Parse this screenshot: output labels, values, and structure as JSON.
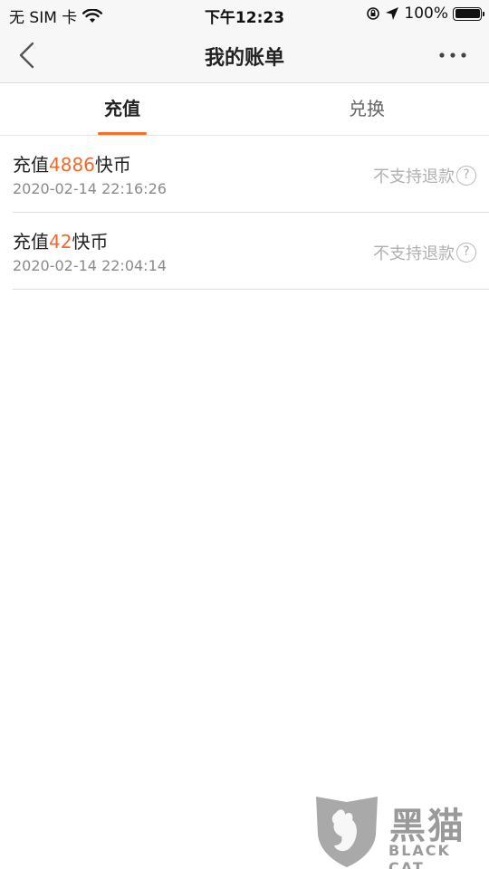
{
  "status_bar": {
    "carrier": "无 SIM 卡",
    "time": "下午12:23",
    "battery_text": "100%",
    "battery_level": 1.0
  },
  "nav": {
    "title": "我的账单",
    "back_icon": "chevron-left-icon",
    "more_icon": "more-horizontal-icon"
  },
  "tabs": [
    {
      "label": "充值",
      "active": true
    },
    {
      "label": "兑换",
      "active": false
    }
  ],
  "bills": [
    {
      "prefix": "充值",
      "amount": "4886",
      "suffix": "快币",
      "time": "2020-02-14 22:16:26",
      "refund_label": "不支持退款"
    },
    {
      "prefix": "充值",
      "amount": "42",
      "suffix": "快币",
      "time": "2020-02-14 22:04:14",
      "refund_label": "不支持退款"
    }
  ],
  "watermark": {
    "cn": "黑猫",
    "en": "BLACK CAT"
  },
  "colors": {
    "accent": "#f06a2b",
    "tab_underline": "#ff6b27"
  }
}
